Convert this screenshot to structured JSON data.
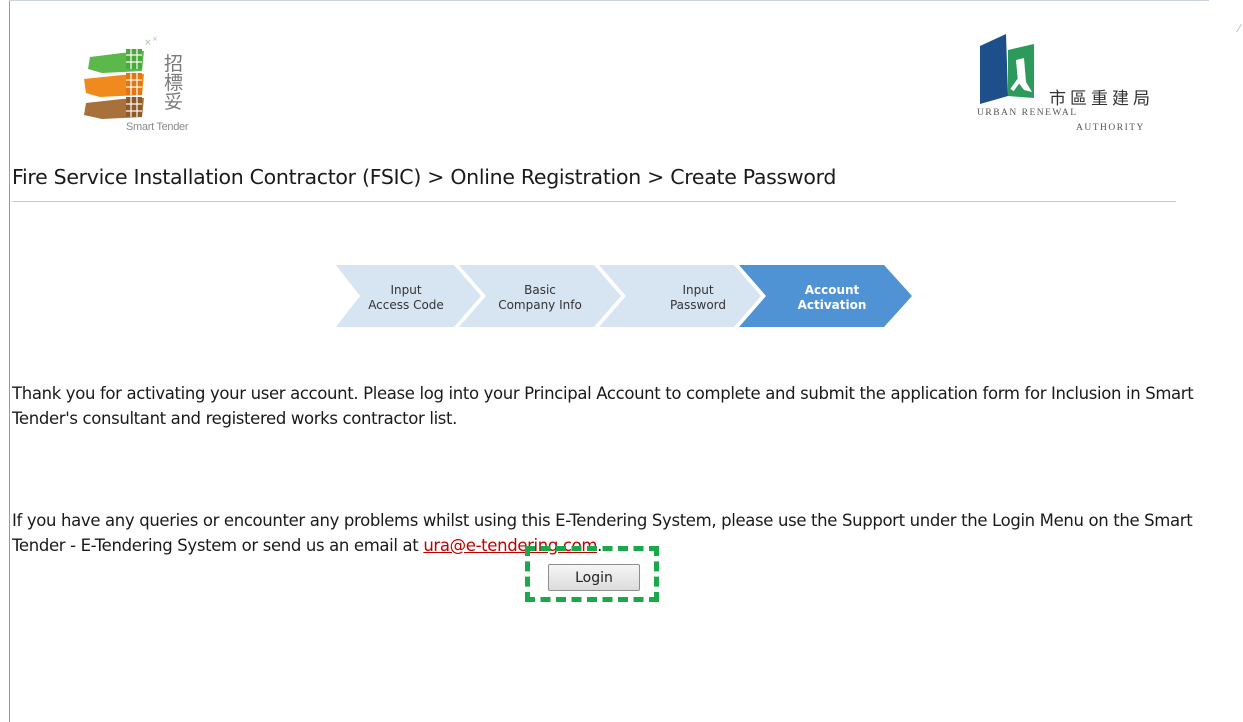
{
  "logos": {
    "smart_tender_caption": "Smart Tender",
    "smart_tender_zh": "招標妥",
    "ura_zh": "市區重建局",
    "ura_en_line1": "URBAN RENEWAL",
    "ura_en_line2": "AUTHORITY"
  },
  "breadcrumb": "Fire Service Installation Contractor (FSIC) > Online Registration > Create Password",
  "steps": [
    {
      "line1": "Input",
      "line2": "Access Code",
      "active": false
    },
    {
      "line1": "Basic",
      "line2": "Company Info",
      "active": false
    },
    {
      "line1": "Input",
      "line2": "Password",
      "active": false
    },
    {
      "line1": "Account",
      "line2": "Activation",
      "active": true
    }
  ],
  "colors": {
    "step_inactive": "#d7e4f1",
    "step_active": "#4f93d4",
    "link": "#c00000",
    "highlight": "#1aa84a"
  },
  "message": {
    "thank_you": "Thank you for activating your user account. Please log into your Principal Account to complete and submit the application form for Inclusion in Smart Tender's consultant and registered works contractor list.",
    "support_text": "If you have any queries or encounter any problems whilst using this E-Tendering System, please use the Support under the Login Menu on the Smart Tender - E-Tendering System or send us an email at ",
    "support_email": "ura@e-tendering.com",
    "support_end": "."
  },
  "login_button": "Login"
}
